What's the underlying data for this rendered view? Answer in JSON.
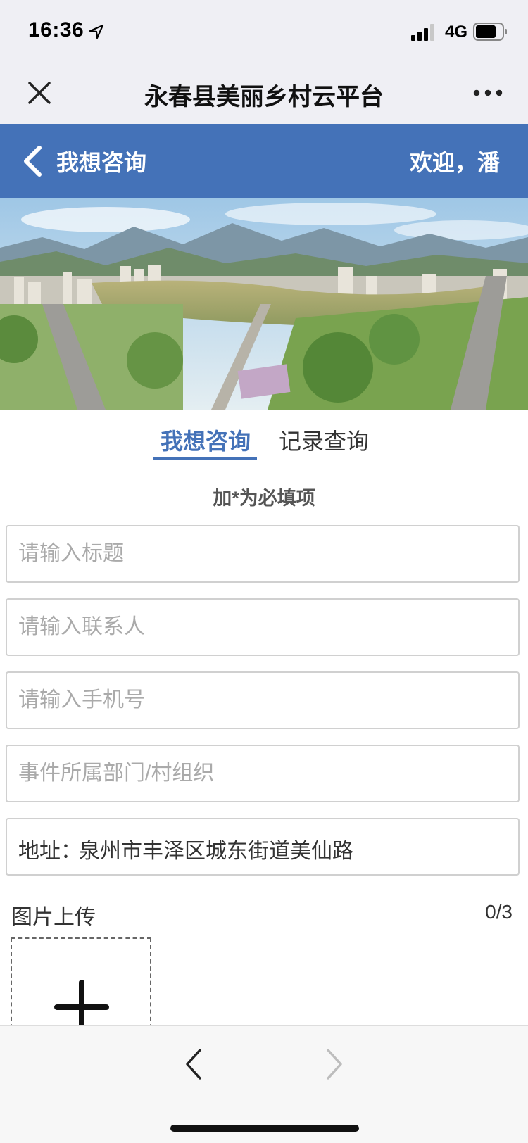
{
  "status_bar": {
    "time": "16:36",
    "network": "4G",
    "icons": [
      "location-arrow-icon",
      "signal-icon",
      "battery-icon"
    ]
  },
  "wechat_nav": {
    "title": "永春县美丽乡村云平台",
    "icons": [
      "close-icon",
      "more-icon"
    ]
  },
  "header": {
    "title": "我想咨询",
    "welcome": "欢迎，潘",
    "background": "#4472b8",
    "icons": [
      "back-chevron-icon"
    ]
  },
  "tabs": [
    {
      "label": "我想咨询",
      "active": true
    },
    {
      "label": "记录查询",
      "active": false
    }
  ],
  "form": {
    "required_note": "加*为必填项",
    "title_placeholder": "请输入标题",
    "contact_placeholder": "请输入联系人",
    "phone_placeholder": "请输入手机号",
    "department_placeholder": "事件所属部门/村组织",
    "address_label": "地址：",
    "address_value": "泉州市丰泽区城东街道美仙路"
  },
  "upload": {
    "label": "图片上传",
    "count": "0/3",
    "icons": [
      "plus-icon"
    ]
  },
  "bottom_bar": {
    "icons": [
      "back-arrow-icon",
      "forward-arrow-icon"
    ]
  },
  "colors": {
    "accent": "#4472b8",
    "system_bar": "#efeff4"
  }
}
